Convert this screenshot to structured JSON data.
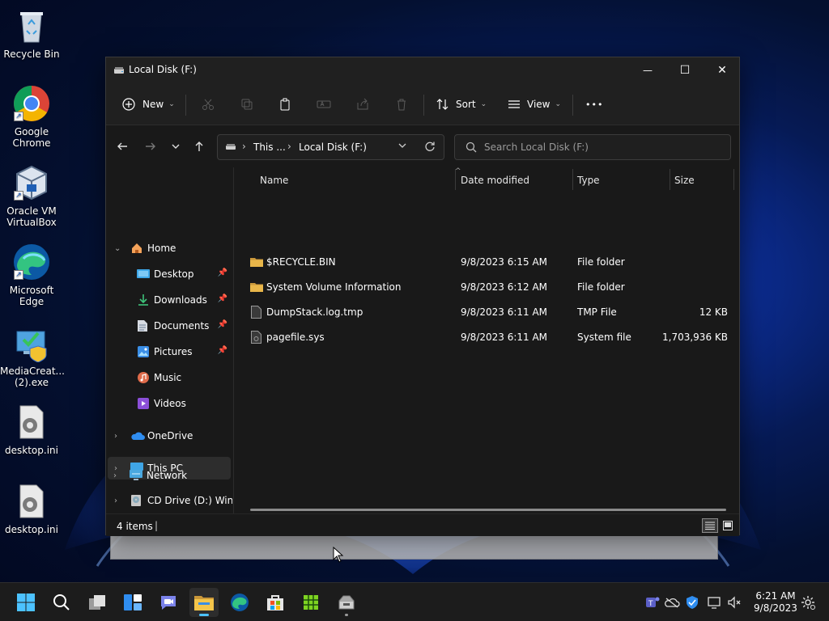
{
  "desktop": {
    "icons": [
      {
        "label": "Recycle Bin"
      },
      {
        "label": "Google\nChrome"
      },
      {
        "label": "Oracle VM\nVirtualBox"
      },
      {
        "label": "Microsoft\nEdge"
      },
      {
        "label": "MediaCreat...\n(2).exe"
      },
      {
        "label": "desktop.ini"
      },
      {
        "label": "desktop.ini"
      }
    ]
  },
  "window": {
    "title": "Local Disk (F:)",
    "controls": {
      "minimize": "—",
      "maximize": "☐",
      "close": "✕"
    }
  },
  "command_bar": {
    "new_label": "New",
    "sort_label": "Sort",
    "view_label": "View",
    "more_label": "•••"
  },
  "address_bar": {
    "crumbs": [
      "This ...",
      "Local Disk (F:)"
    ]
  },
  "search": {
    "placeholder": "Search Local Disk (F:)"
  },
  "nav_pane": {
    "items": [
      {
        "label": "Home"
      },
      {
        "label": "Desktop"
      },
      {
        "label": "Downloads"
      },
      {
        "label": "Documents"
      },
      {
        "label": "Pictures"
      },
      {
        "label": "Music"
      },
      {
        "label": "Videos"
      },
      {
        "label": "OneDrive"
      },
      {
        "label": "This PC"
      },
      {
        "label": "CD Drive (D:) Windo"
      },
      {
        "label": "Network"
      }
    ]
  },
  "files": {
    "columns": [
      "Name",
      "Date modified",
      "Type",
      "Size"
    ],
    "rows": [
      {
        "name": "$RECYCLE.BIN",
        "date": "9/8/2023 6:15 AM",
        "type": "File folder",
        "size": ""
      },
      {
        "name": "System Volume Information",
        "date": "9/8/2023 6:12 AM",
        "type": "File folder",
        "size": ""
      },
      {
        "name": "DumpStack.log.tmp",
        "date": "9/8/2023 6:11 AM",
        "type": "TMP File",
        "size": "12 KB"
      },
      {
        "name": "pagefile.sys",
        "date": "9/8/2023 6:11 AM",
        "type": "System file",
        "size": "1,703,936 KB"
      }
    ]
  },
  "status_bar": {
    "items_count": "4 items",
    "separator": "|"
  },
  "taskbar": {
    "clock_time": "6:21 AM",
    "clock_date": "9/8/2023"
  },
  "colors": {
    "accent": "#4cc2ff",
    "folder": "#e8b64a",
    "window_bg": "#191919",
    "taskbar_bg": "#1c1c1c"
  }
}
